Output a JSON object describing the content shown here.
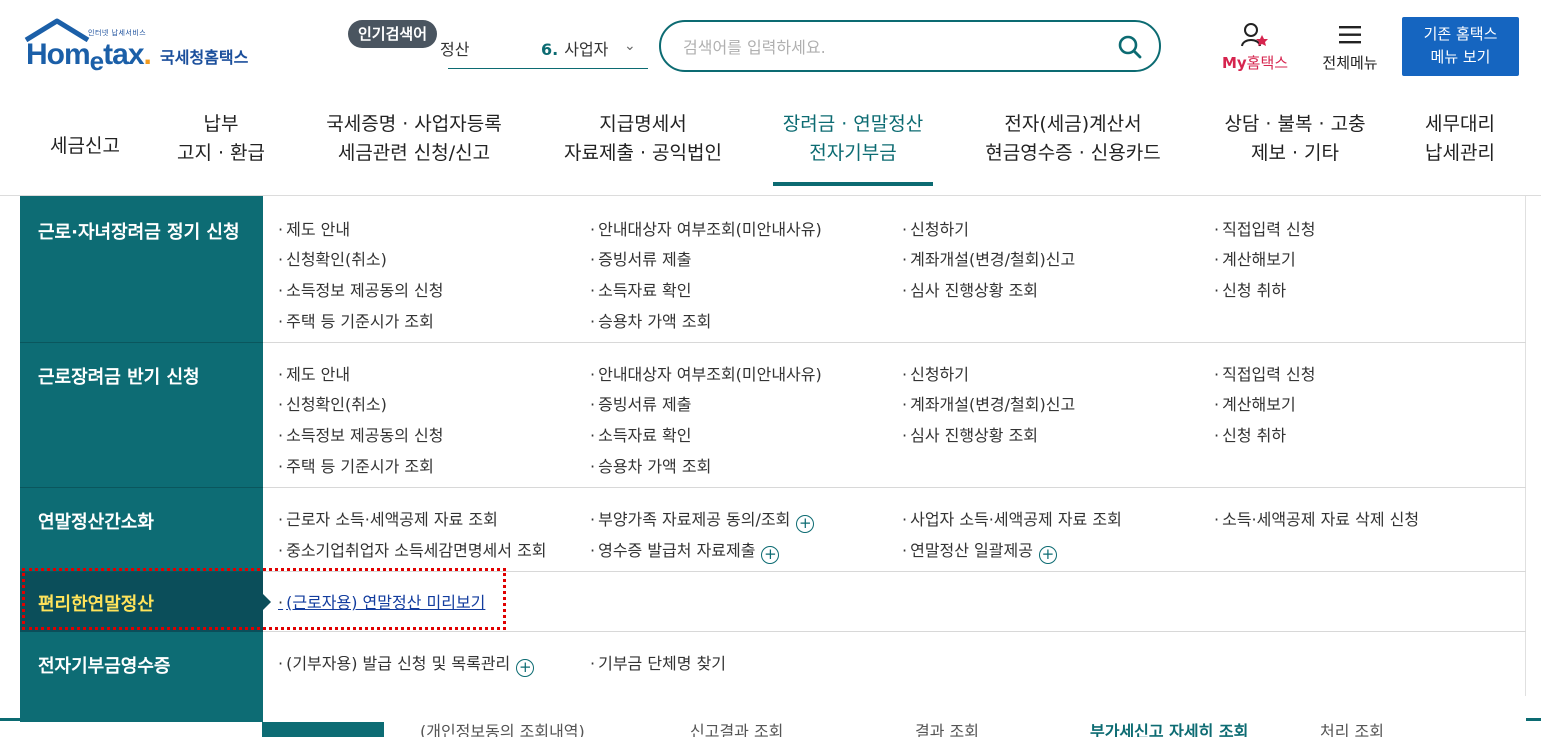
{
  "header": {
    "logo": {
      "tagline": "인터넷 납세서비스",
      "mark_home": "Hom",
      "mark_e": "e",
      "mark_tax": "tax",
      "mark_dot": ".",
      "name": "국세청홈택스"
    },
    "popular": {
      "badge": "인기검색어",
      "prev_item_fragment": "정산",
      "current_num": "6.",
      "current_text": "사업자"
    },
    "search": {
      "placeholder": "검색어를 입력하세요."
    },
    "my_hometax_prefix": "My",
    "my_hometax_suffix": "홈택스",
    "all_menu": "전체메뉴",
    "old_hometax_line1": "기존 홈택스",
    "old_hometax_line2": "메뉴 보기"
  },
  "gnb": [
    {
      "line1": "세금신고",
      "line2": ""
    },
    {
      "line1": "납부",
      "line2": "고지 · 환급"
    },
    {
      "line1": "국세증명 · 사업자등록",
      "line2": "세금관련 신청/신고"
    },
    {
      "line1": "지급명세서",
      "line2": "자료제출 · 공익법인"
    },
    {
      "line1": "장려금 · 연말정산",
      "line2": "전자기부금"
    },
    {
      "line1": "전자(세금)계산서",
      "line2": "현금영수증 · 신용카드"
    },
    {
      "line1": "상담 · 불복 · 고충",
      "line2": "제보 · 기타"
    },
    {
      "line1": "세무대리",
      "line2": "납세관리"
    }
  ],
  "mega": {
    "sections": [
      {
        "title": "근로·자녀장려금 정기 신청",
        "items": [
          "제도 안내",
          "안내대상자 여부조회(미안내사유)",
          "신청하기",
          "직접입력 신청",
          "신청확인(취소)",
          "증빙서류 제출",
          "계좌개설(변경/철회)신고",
          "계산해보기",
          "소득정보 제공동의 신청",
          "소득자료 확인",
          "심사 진행상황 조회",
          "신청 취하",
          "주택 등 기준시가 조회",
          "승용차 가액 조회"
        ]
      },
      {
        "title": "근로장려금 반기 신청",
        "items": [
          "제도 안내",
          "안내대상자 여부조회(미안내사유)",
          "신청하기",
          "직접입력 신청",
          "신청확인(취소)",
          "증빙서류 제출",
          "계좌개설(변경/철회)신고",
          "계산해보기",
          "소득정보 제공동의 신청",
          "소득자료 확인",
          "심사 진행상황 조회",
          "신청 취하",
          "주택 등 기준시가 조회",
          "승용차 가액 조회"
        ]
      },
      {
        "title": "연말정산간소화",
        "items": [
          "근로자 소득·세액공제 자료 조회",
          "부양가족 자료제공 동의/조회",
          "사업자 소득·세액공제 자료 조회",
          "소득·세액공제 자료 삭제 신청",
          "중소기업취업자 소득세감면명세서 조회",
          "영수증 발급처 자료제출",
          "연말정산 일괄제공"
        ]
      },
      {
        "title": "편리한연말정산",
        "items": [
          "(근로자용) 연말정산 미리보기"
        ]
      },
      {
        "title": "전자기부금영수증",
        "items": [
          "(기부자용) 발급 신청 및 목록관리",
          "기부금 단체명 찾기"
        ]
      }
    ]
  },
  "behind_row": [
    "(개인정보동의 조회내역)",
    "신고결과 조회",
    "결과 조회",
    "부가세신고 자세히 조회",
    "처리 조회"
  ]
}
